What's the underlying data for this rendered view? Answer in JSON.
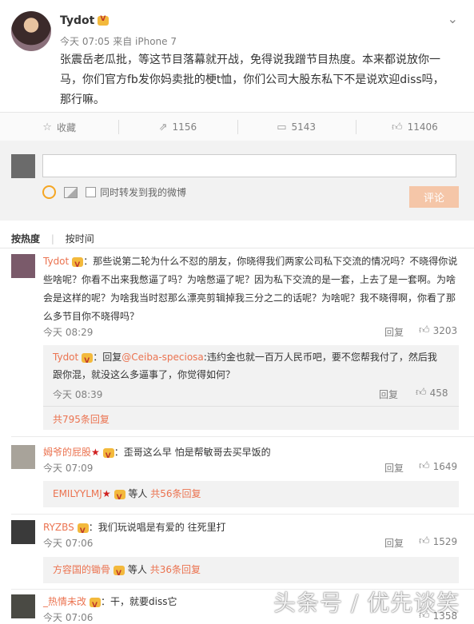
{
  "post": {
    "author": "Tydot",
    "meta": "今天 07:05 来自 iPhone 7",
    "text": "张震岳老瓜批，等这节目落幕就开战，免得说我蹭节目热度。本来都说放你一马，你们官方fb发你妈卖批的梗t恤，你们公司大股东私下不是说欢迎diss吗，那行嘛。"
  },
  "actions": {
    "favorite": "收藏",
    "repost": "1156",
    "comment": "5143",
    "like": "11406"
  },
  "composer": {
    "sync_label": "同时转发到我的微博",
    "submit": "评论"
  },
  "sort": {
    "hot": "按热度",
    "time": "按时间"
  },
  "comments": [
    {
      "user": "Tydot",
      "text": "：那些说第二轮为什么不怼的朋友，你晓得我们两家公司私下交流的情况吗？不晓得你说些啥呢？你看不出来我憋逼了吗？为啥憋逼了呢？因为私下交流的是一套，上去了是一套啊。为啥会是这样的呢？为啥我当时怼那么漂亮剪辑掉我三分之二的话呢？为啥呢？我不晓得啊，你看了那么多节目你不晓得吗？",
      "time": "今天 08:29",
      "reply": "回复",
      "likes": "3203",
      "sub": {
        "user": "Tydot",
        "prefix": "：回复",
        "mention": "@Ceiba-speciosa",
        "text": ":违约金也就一百万人民币吧，要不您帮我付了，然后我跟你混，就没这么多逼事了，你觉得如何？",
        "time": "今天 08:39",
        "reply": "回复",
        "likes": "458"
      },
      "more": "共795条回复"
    },
    {
      "user": "姆爷的屁股",
      "text": "：歪哥这么早 怕是帮敏哥去买早饭的",
      "time": "今天 07:09",
      "reply": "回复",
      "likes": "1649",
      "summary_user": "EMILYYLMJ",
      "summary_mid": "等人",
      "summary_more": "共56条回复"
    },
    {
      "user": "RYZBS",
      "text": "：我们玩说唱是有爱的 往死里打",
      "time": "今天 07:06",
      "reply": "回复",
      "likes": "1529",
      "summary_user": "方容国的锄骨",
      "summary_mid": "等人",
      "summary_more": "共36条回复"
    },
    {
      "user": "_热情未改",
      "text": "：干，就要diss它",
      "time": "今天 07:06",
      "likes": "1358"
    }
  ],
  "watermark": "头条号 / 优先谈笑"
}
